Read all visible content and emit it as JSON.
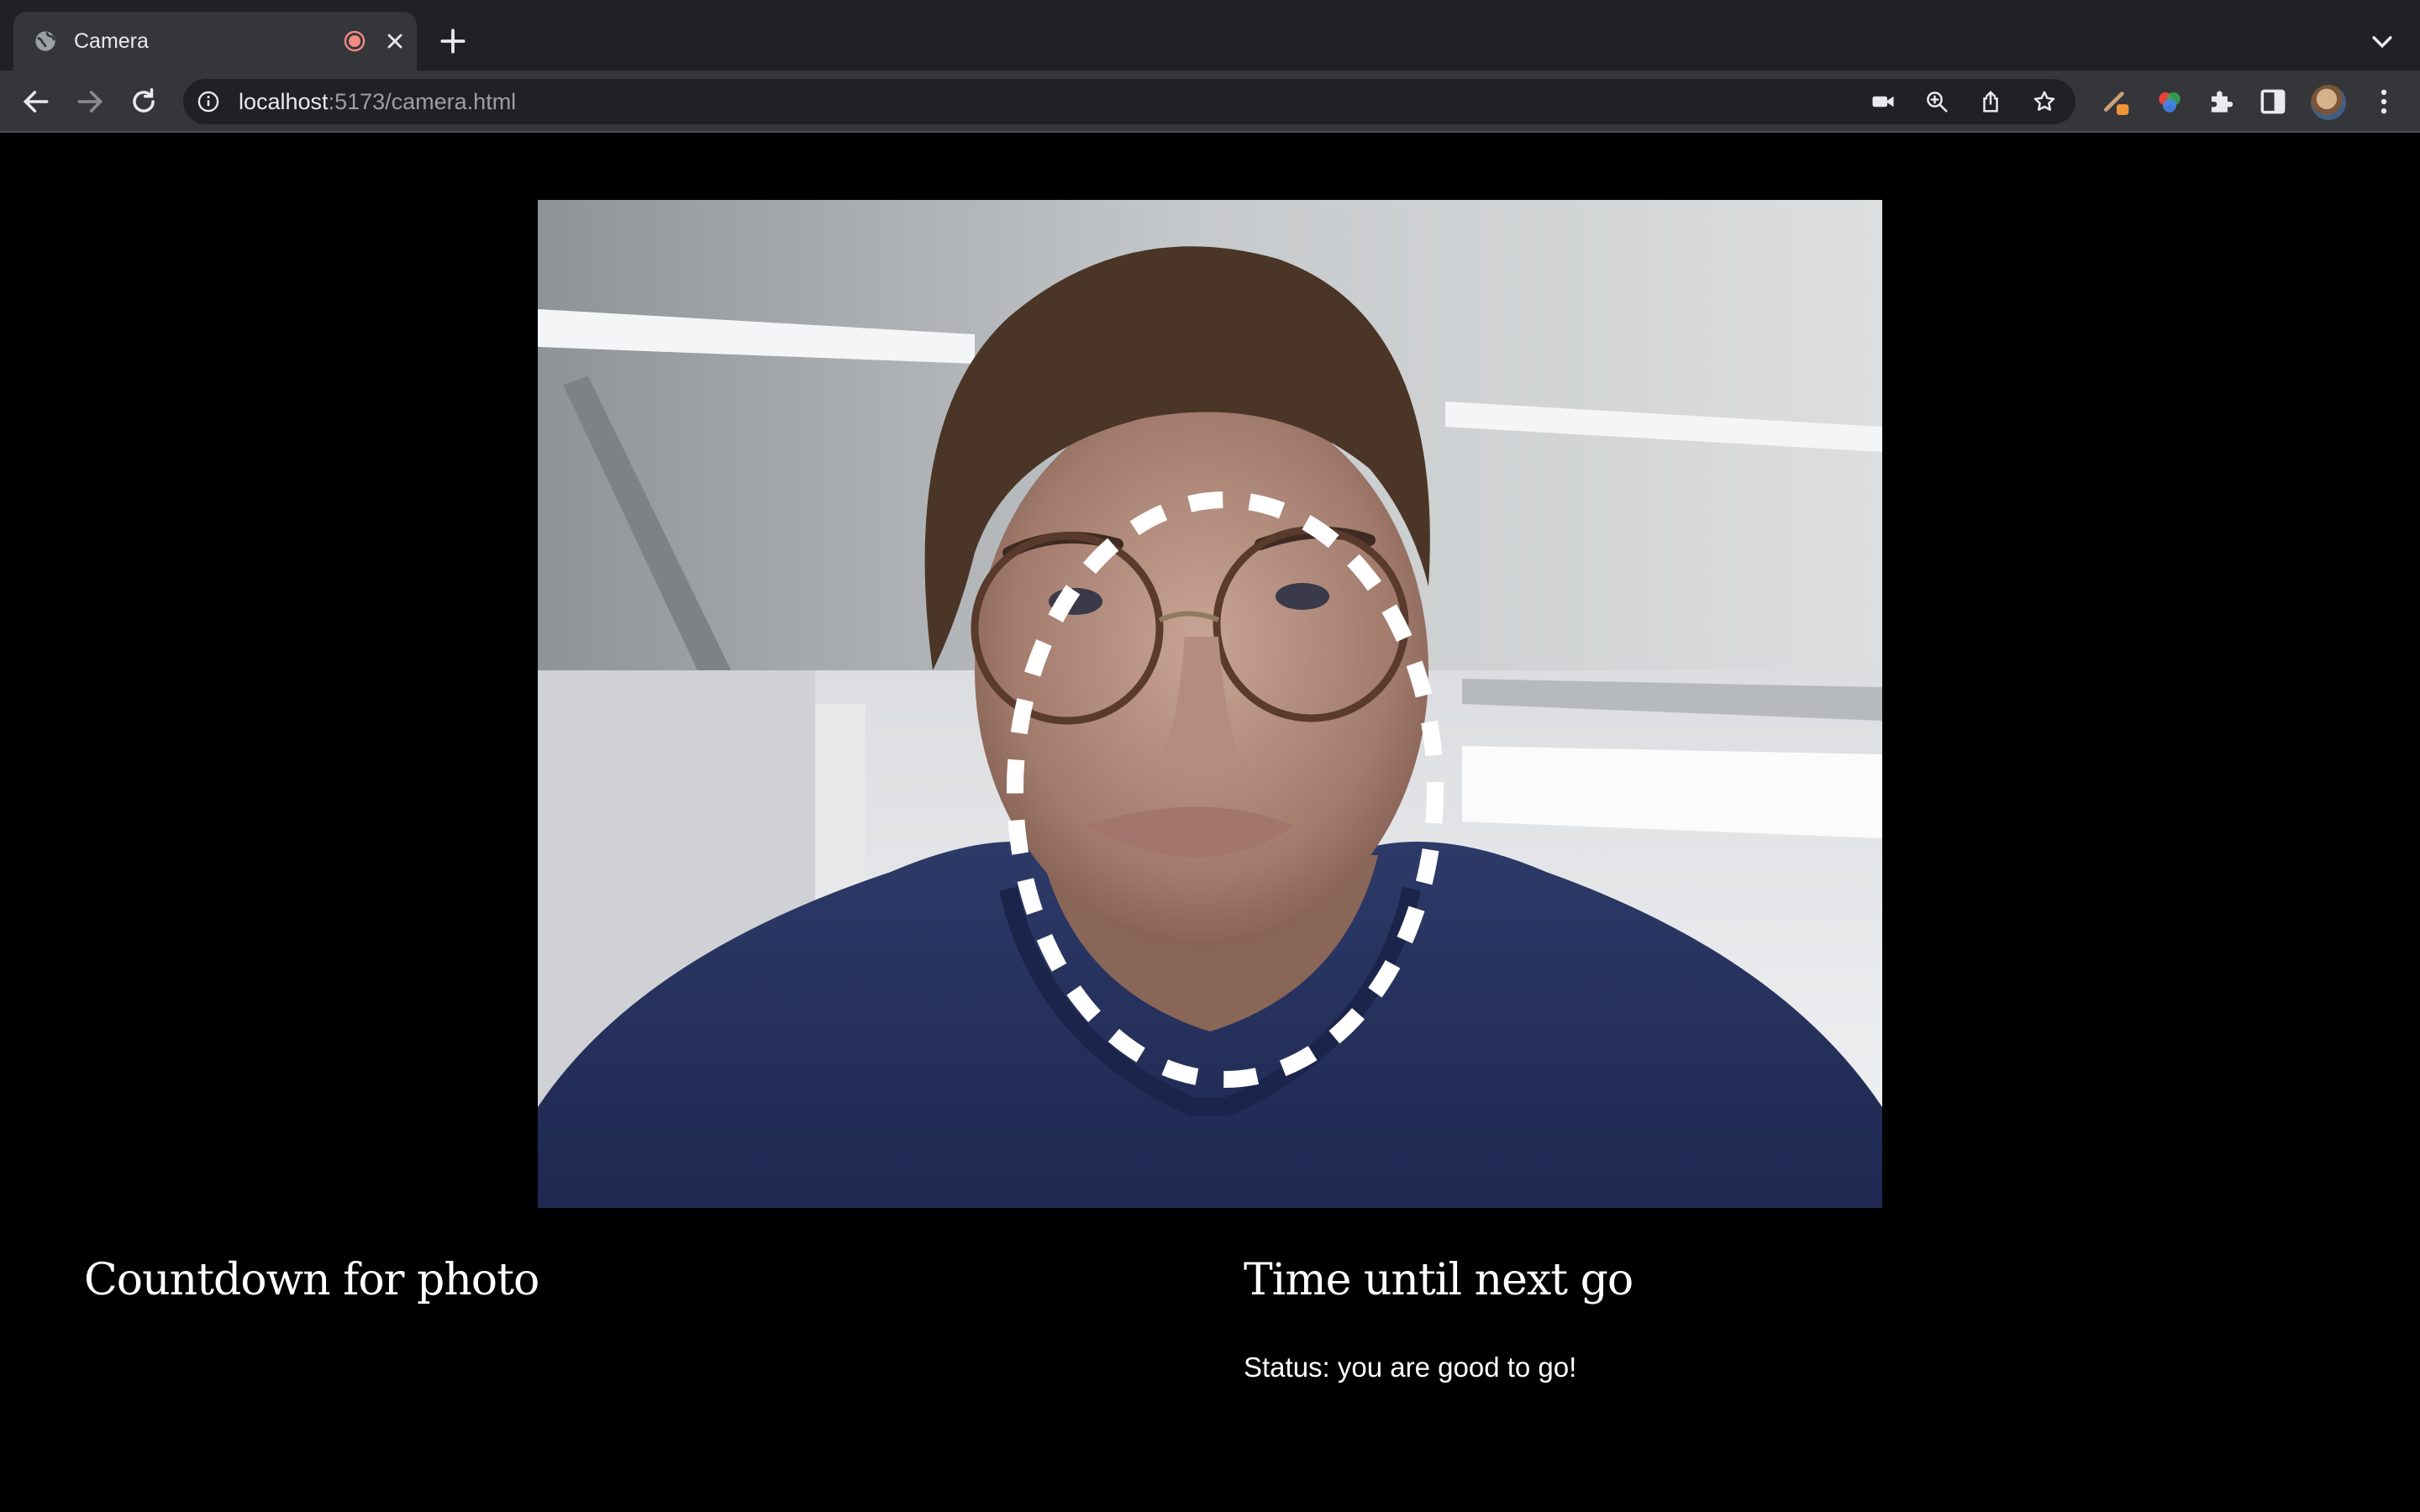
{
  "browser": {
    "tab": {
      "title": "Camera",
      "icons": [
        "globe-icon",
        "recording-icon",
        "close-icon"
      ]
    },
    "new_tab_icon": "plus-icon",
    "tab_menu_icon": "chevron-down-icon",
    "url_host": "localhost",
    "url_rest": ":5173/camera.html",
    "toolbar_icons": [
      "back-icon",
      "forward-icon",
      "reload-icon",
      "camera-icon",
      "zoom-icon",
      "share-icon",
      "star-icon",
      "extension-icons",
      "puzzle-icon",
      "side-panel-icon",
      "profile-avatar",
      "kebab-menu-icon"
    ]
  },
  "page": {
    "countdown_heading": "Countdown for photo",
    "next_go_heading": "Time until next go",
    "status_text": "Status: you are good to go!"
  },
  "colors": {
    "chrome_dark": "#202124",
    "chrome_toolbar": "#35363a",
    "page_background": "#000000",
    "overlay_stroke": "#ffffff"
  }
}
